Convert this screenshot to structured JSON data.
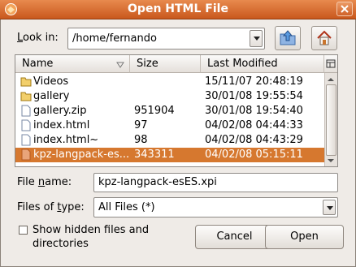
{
  "window": {
    "title": "Open HTML File"
  },
  "look_in": {
    "label_prefix": "",
    "label_accel": "L",
    "label_rest": "ook in:",
    "path": "/home/fernando"
  },
  "columns": {
    "name": "Name",
    "size": "Size",
    "modified": "Last Modified"
  },
  "files": [
    {
      "name": "Videos",
      "size": "",
      "modified": "15/11/07 20:48:19",
      "icon": "folder-icon"
    },
    {
      "name": "gallery",
      "size": "",
      "modified": "30/01/08 19:55:54",
      "icon": "folder-icon"
    },
    {
      "name": "gallery.zip",
      "size": "951904",
      "modified": "30/01/08 19:54:40",
      "icon": "file-icon"
    },
    {
      "name": "index.html",
      "size": "97",
      "modified": "04/02/08 04:44:33",
      "icon": "file-icon"
    },
    {
      "name": "index.html~",
      "size": "98",
      "modified": "04/02/08 04:43:29",
      "icon": "file-icon"
    },
    {
      "name": "kpz-langpack-es...",
      "size": "343311",
      "modified": "04/02/08 05:15:11",
      "icon": "file-icon",
      "selected": true
    }
  ],
  "file_name": {
    "label_prefix": "File ",
    "label_accel": "n",
    "label_rest": "ame:",
    "value": "kpz-langpack-esES.xpi"
  },
  "file_type": {
    "label_prefix": "Files of ",
    "label_accel": "t",
    "label_rest": "ype:",
    "value": "All Files (*)"
  },
  "show_hidden": {
    "line1": "Show hidden files and",
    "line2": "directories",
    "checked": false
  },
  "buttons": {
    "cancel": "Cancel",
    "open": "Open"
  },
  "colors": {
    "titlebar": "#d8692c",
    "selection": "#d6782f",
    "window_bg": "#efebe7"
  }
}
